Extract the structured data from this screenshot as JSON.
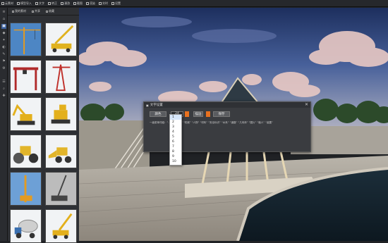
{
  "toolbar": {
    "items": [
      {
        "icon": "folder-icon",
        "label": "云素材"
      },
      {
        "icon": "import-icon",
        "label": "模型导入"
      },
      {
        "icon": "text-icon",
        "label": "文字"
      },
      {
        "icon": "rotate-icon",
        "label": "转正"
      },
      {
        "icon": "play-icon",
        "label": "漫游"
      },
      {
        "icon": "screenshot-icon",
        "label": "截图"
      },
      {
        "icon": "render-icon",
        "label": "渲染"
      },
      {
        "icon": "realtime-icon",
        "label": "实时"
      },
      {
        "icon": "settings-icon",
        "label": "设置"
      }
    ]
  },
  "left_tools": [
    "≡",
    "⌂",
    "▣",
    "◆",
    "✦",
    "◐",
    "✎",
    "⚑",
    "⚙",
    "☰",
    "⌕",
    "✚"
  ],
  "library": {
    "tabs": [
      {
        "icon": "import-icon",
        "label": "我的素材"
      },
      {
        "icon": "upload-icon",
        "label": "共享"
      },
      {
        "icon": "star-icon",
        "label": "收藏"
      }
    ],
    "thumbnails": [
      {
        "name": "tower-crane-thumb",
        "kind": "crane",
        "color": "#e89a1c"
      },
      {
        "name": "truck-crane-thumb",
        "kind": "truck",
        "color": "#e0b21e"
      },
      {
        "name": "gantry-crane-thumb",
        "kind": "gantry",
        "color": "#b02a2a"
      },
      {
        "name": "tower-frame-thumb",
        "kind": "tower",
        "color": "#c0302a"
      },
      {
        "name": "excavator-thumb",
        "kind": "excavator",
        "color": "#e3b01c"
      },
      {
        "name": "bulldozer-thumb",
        "kind": "dozer",
        "color": "#e3b01c"
      },
      {
        "name": "road-roller-thumb",
        "kind": "roller",
        "color": "#e2b52a"
      },
      {
        "name": "wheel-loader-thumb",
        "kind": "loader",
        "color": "#e2b52a"
      },
      {
        "name": "drill-rig-thumb",
        "kind": "drill",
        "color": "#e39b22"
      },
      {
        "name": "crawler-crane-thumb",
        "kind": "crawler",
        "color": "#777777"
      },
      {
        "name": "mixer-truck-thumb",
        "kind": "mixer",
        "color": "#cfcfcf"
      },
      {
        "name": "boom-lift-thumb",
        "kind": "boom",
        "color": "#e3b01c"
      }
    ]
  },
  "dialog": {
    "title": "文字设置",
    "close": "✕",
    "font_label": "颜色",
    "size_value": "24",
    "style_label": "描边",
    "save_label": "保存",
    "body_text": "一级菜单词组：“……” “建筑” “机械” “人物” “材料” “安全标识” “水系” “道路” “几何体” “图片” “植人” “装置”",
    "accent": "#e8711f"
  },
  "size_dropdown": {
    "selected": "1",
    "options": [
      "1",
      "2",
      "3",
      "4",
      "5",
      "6",
      "7",
      "8",
      "9",
      "10"
    ]
  }
}
